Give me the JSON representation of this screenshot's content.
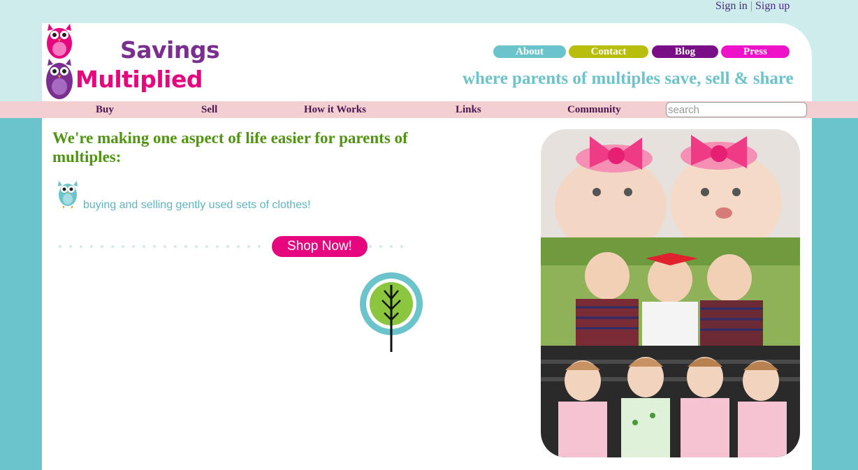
{
  "header": {
    "sign_in": "Sign in",
    "separator": "|",
    "sign_up": "Sign up",
    "logo_line1": "Savings",
    "logo_line2": "Multiplied",
    "tagline": "where parents of multiples save, sell & share"
  },
  "top_nav": [
    {
      "label": "About",
      "color": "#6bc3cc"
    },
    {
      "label": "Contact",
      "color": "#b9bd0b"
    },
    {
      "label": "Blog",
      "color": "#7a0e86"
    },
    {
      "label": "Press",
      "color": "#ee13c9"
    }
  ],
  "main_nav": {
    "items": [
      "Buy",
      "Sell",
      "How it Works",
      "Links",
      "Community"
    ],
    "search_placeholder": "search"
  },
  "content": {
    "headline": "We're making one aspect of life easier for parents of multiples:",
    "feature_text": "buying and selling gently used sets of clothes!",
    "shop_button": "Shop Now!"
  },
  "colors": {
    "background_teal": "#6bc3cc",
    "top_band": "#cdeceb",
    "nav_band": "#f3cfd1",
    "logo_purple": "#7a2e90",
    "logo_pink": "#e6077f",
    "headline_green": "#4f9512",
    "nav_text": "#4a1650"
  },
  "icons": [
    "owl-logo-icon",
    "owl-bullet-icon",
    "tree-icon"
  ]
}
